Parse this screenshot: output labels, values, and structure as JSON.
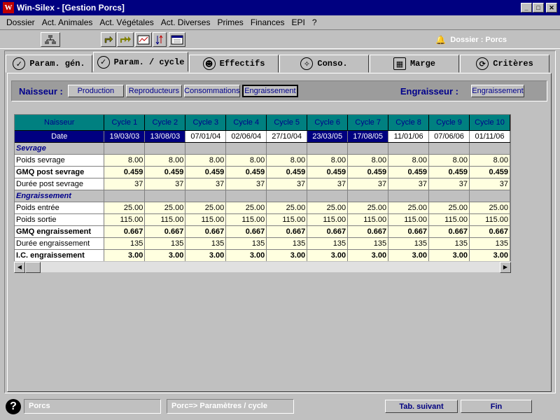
{
  "window": {
    "title": "Win-Silex - [Gestion Porcs]"
  },
  "menu": [
    "Dossier",
    "Act. Animales",
    "Act. Végétales",
    "Act. Diverses",
    "Primes",
    "Finances",
    "EPI",
    "?"
  ],
  "dossier_label": "Dossier : Porcs",
  "tabs": [
    {
      "label": "Param. gén.",
      "icon": "check-dial-icon"
    },
    {
      "label": "Param. / cycle",
      "icon": "check-dial-icon"
    },
    {
      "label": "Effectifs",
      "icon": "people-icon"
    },
    {
      "label": "Conso.",
      "icon": "compass-icon"
    },
    {
      "label": "Marge",
      "icon": "calculator-icon"
    },
    {
      "label": "Critères",
      "icon": "refresh-icon"
    }
  ],
  "subbar": {
    "naisseur_label": "Naisseur :",
    "naisseur_buttons": [
      "Production",
      "Reproducteurs",
      "Consommations",
      "Engraissement"
    ],
    "engraisseur_label": "Engraisseur :",
    "engraisseur_button": "Engraissement"
  },
  "grid": {
    "corner": "Naisseur",
    "columns": [
      "Cycle 1",
      "Cycle 2",
      "Cycle 3",
      "Cycle 4",
      "Cycle 5",
      "Cycle 6",
      "Cycle 7",
      "Cycle 8",
      "Cycle 9",
      "Cycle 10"
    ],
    "date_label": "Date",
    "dates": [
      "19/03/03",
      "13/08/03",
      "07/01/04",
      "02/06/04",
      "27/10/04",
      "23/03/05",
      "17/08/05",
      "11/01/06",
      "07/06/06",
      "01/11/06"
    ],
    "rows": [
      {
        "type": "section",
        "label": "Sevrage"
      },
      {
        "type": "data",
        "label": "Poids sevrage",
        "bold": false,
        "values": [
          "8.00",
          "8.00",
          "8.00",
          "8.00",
          "8.00",
          "8.00",
          "8.00",
          "8.00",
          "8.00",
          "8.00"
        ]
      },
      {
        "type": "data",
        "label": "GMQ post sevrage",
        "bold": true,
        "values": [
          "0.459",
          "0.459",
          "0.459",
          "0.459",
          "0.459",
          "0.459",
          "0.459",
          "0.459",
          "0.459",
          "0.459"
        ]
      },
      {
        "type": "data",
        "label": "Durée post sevrage",
        "bold": false,
        "values": [
          "37",
          "37",
          "37",
          "37",
          "37",
          "37",
          "37",
          "37",
          "37",
          "37"
        ]
      },
      {
        "type": "section",
        "label": "Engraissement"
      },
      {
        "type": "data",
        "label": "Poids entrée",
        "bold": false,
        "values": [
          "25.00",
          "25.00",
          "25.00",
          "25.00",
          "25.00",
          "25.00",
          "25.00",
          "25.00",
          "25.00",
          "25.00"
        ]
      },
      {
        "type": "data",
        "label": "Poids sortie",
        "bold": false,
        "values": [
          "115.00",
          "115.00",
          "115.00",
          "115.00",
          "115.00",
          "115.00",
          "115.00",
          "115.00",
          "115.00",
          "115.00"
        ]
      },
      {
        "type": "data",
        "label": "GMQ engraissement",
        "bold": true,
        "values": [
          "0.667",
          "0.667",
          "0.667",
          "0.667",
          "0.667",
          "0.667",
          "0.667",
          "0.667",
          "0.667",
          "0.667"
        ]
      },
      {
        "type": "data",
        "label": "Durée engraissement",
        "bold": false,
        "values": [
          "135",
          "135",
          "135",
          "135",
          "135",
          "135",
          "135",
          "135",
          "135",
          "135"
        ]
      },
      {
        "type": "data",
        "label": "I.C. engraissement",
        "bold": true,
        "values": [
          "3.00",
          "3.00",
          "3.00",
          "3.00",
          "3.00",
          "3.00",
          "3.00",
          "3.00",
          "3.00",
          "3.00"
        ]
      }
    ]
  },
  "status": {
    "left": "Porcs",
    "path": "Porc=> Paramètres / cycle",
    "next_button": "Tab. suivant",
    "end_button": "Fin"
  }
}
